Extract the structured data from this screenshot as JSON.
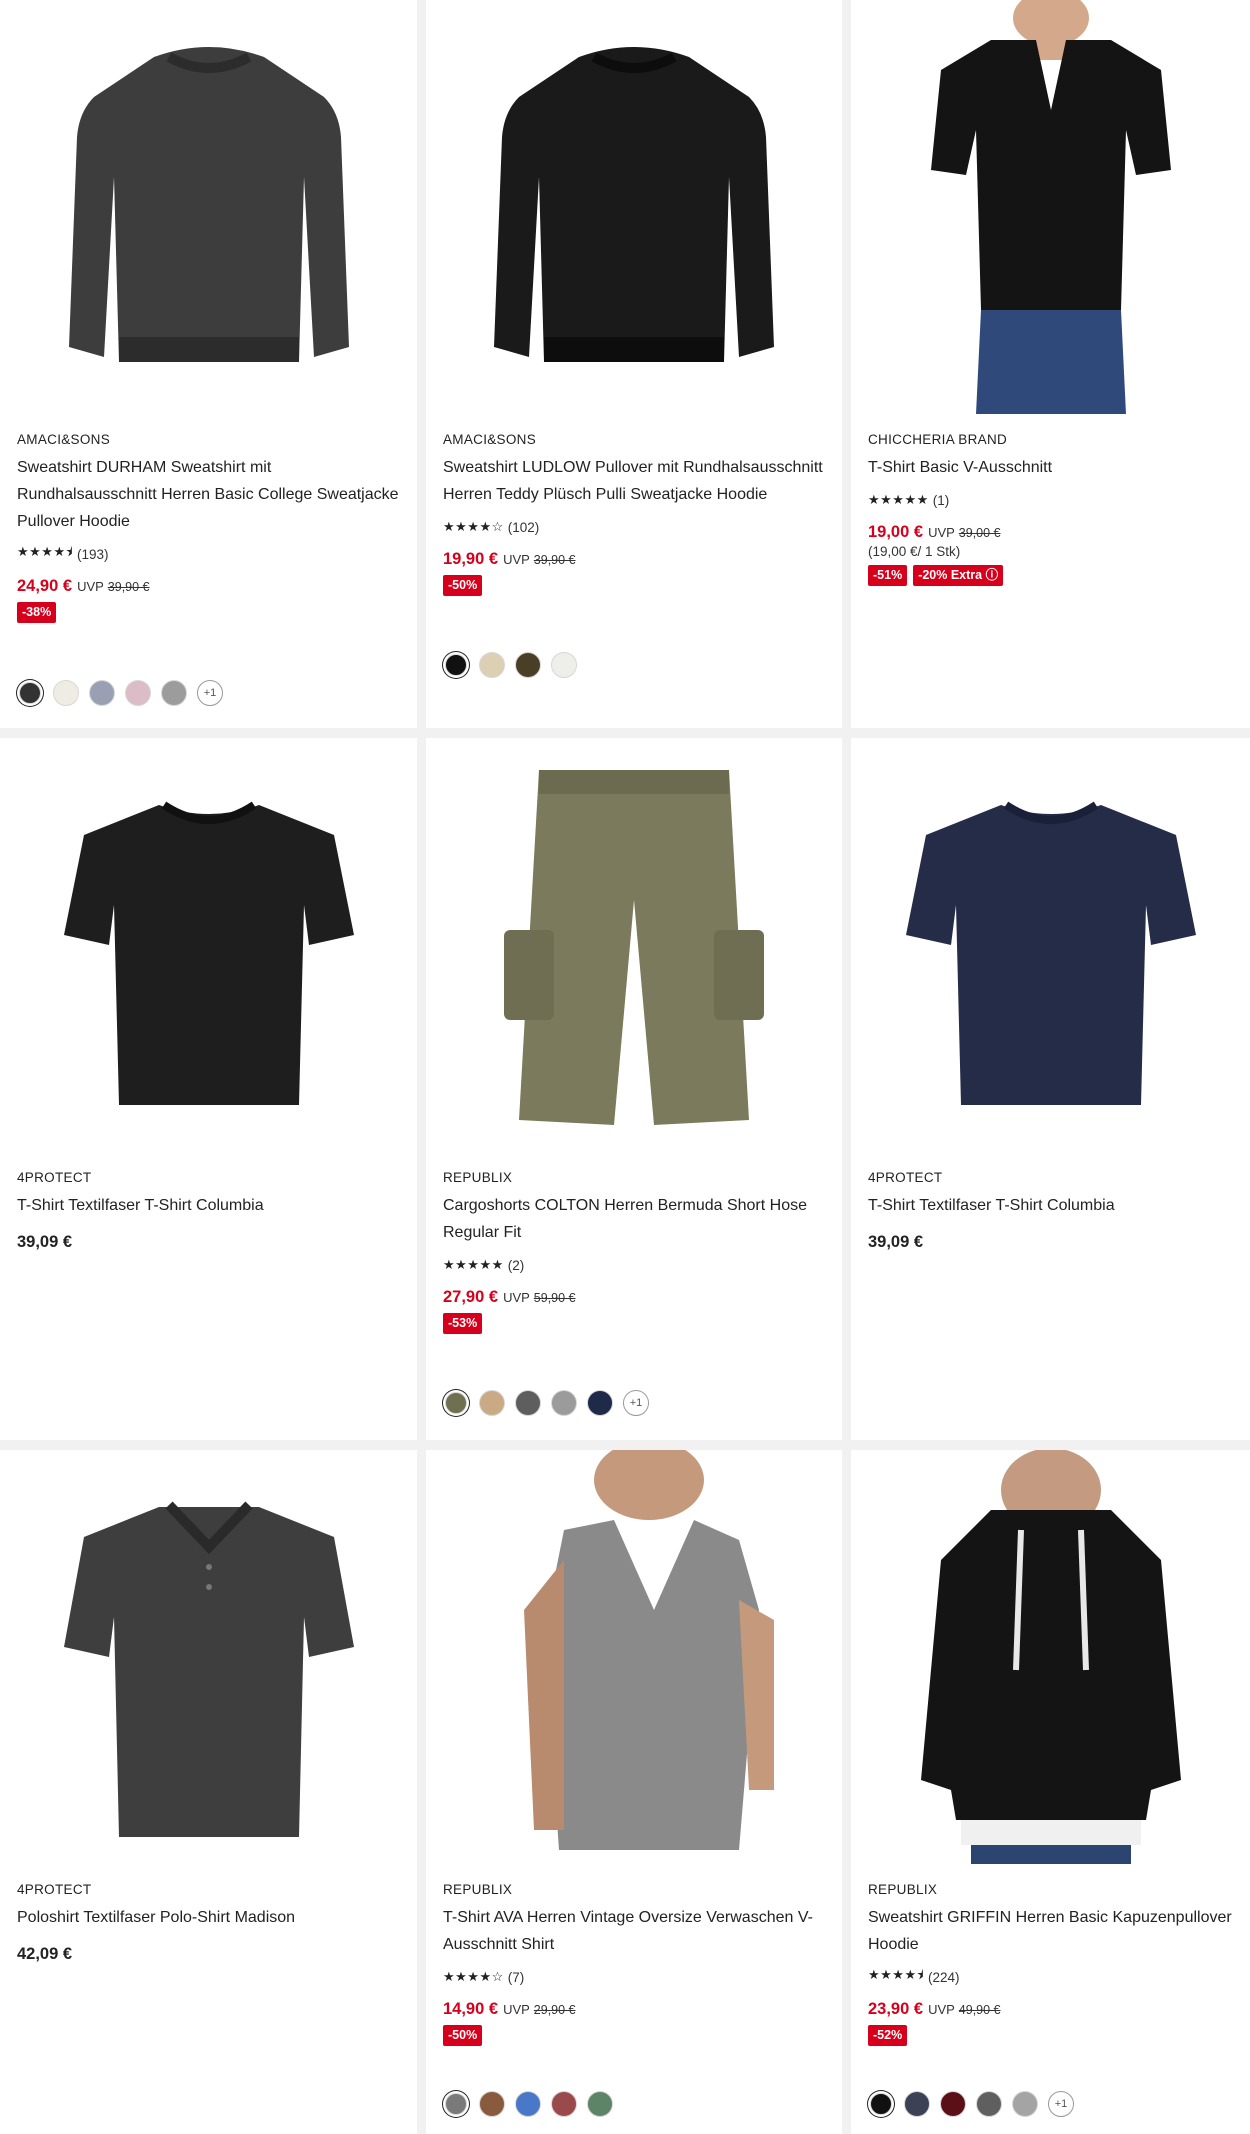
{
  "products": [
    {
      "brand": "AMACI&SONS",
      "title": "Sweatshirt DURHAM Sweatshirt mit Rundhalsausschnitt Herren Basic College Sweatjacke Pullover Hoodie",
      "stars": "★★★★⯨",
      "rating_count": "(193)",
      "price": "24,90 €",
      "uvp_label": "UVP",
      "old_price": "39,90 €",
      "badges": [
        "-38%"
      ],
      "swatch_colors": [
        "#333333",
        "#efece4",
        "#9aa0b4",
        "#dcbcc6",
        "#9c9c9c"
      ],
      "more_colors": "+1",
      "image": "sweatshirt-gray"
    },
    {
      "brand": "AMACI&SONS",
      "title": "Sweatshirt LUDLOW Pullover mit Rundhalsausschnitt Herren Teddy Plüsch Pulli Sweatjacke Hoodie",
      "stars": "★★★★☆",
      "rating_count": "(102)",
      "price": "19,90 €",
      "uvp_label": "UVP",
      "old_price": "39,90 €",
      "badges": [
        "-50%"
      ],
      "swatch_colors": [
        "#111111",
        "#dccfb4",
        "#4a3f26",
        "#efefe9"
      ],
      "image": "sweatshirt-black"
    },
    {
      "brand": "CHICCHERIA BRAND",
      "title": "T-Shirt Basic V-Ausschnitt",
      "stars": "★★★★★",
      "rating_count": "(1)",
      "price": "19,00 €",
      "uvp_label": "UVP",
      "old_price": "39,00 €",
      "unit_price": "(19,00 €/ 1 Stk)",
      "badges": [
        "-51%",
        "-20% Extra ⓘ"
      ],
      "image": "tshirt-vneck-model"
    },
    {
      "brand": "4PROTECT",
      "title": "T-Shirt Textilfaser T-Shirt Columbia",
      "price": "39,09 €",
      "image": "tshirt-black"
    },
    {
      "brand": "REPUBLIX",
      "title": "Cargoshorts COLTON Herren Bermuda Short Hose Regular Fit",
      "stars": "★★★★★",
      "rating_count": "(2)",
      "price": "27,90 €",
      "uvp_label": "UVP",
      "old_price": "59,90 €",
      "badges": [
        "-53%"
      ],
      "swatch_colors": [
        "#6e7050",
        "#c9aa84",
        "#5e5e5e",
        "#9b9b9b",
        "#1f2a48"
      ],
      "more_colors": "+1",
      "image": "cargo-shorts"
    },
    {
      "brand": "4PROTECT",
      "title": "T-Shirt Textilfaser T-Shirt Columbia",
      "price": "39,09 €",
      "image": "tshirt-navy"
    },
    {
      "brand": "4PROTECT",
      "title": "Poloshirt Textilfaser Polo-Shirt Madison",
      "price": "42,09 €",
      "image": "polo-gray"
    },
    {
      "brand": "REPUBLIX",
      "title": "T-Shirt AVA Herren Vintage Oversize Verwaschen V-Ausschnitt Shirt",
      "stars": "★★★★☆",
      "rating_count": "(7)",
      "price": "14,90 €",
      "uvp_label": "UVP",
      "old_price": "29,90 €",
      "badges": [
        "-50%"
      ],
      "swatch_colors": [
        "#7a7a7a",
        "#8a5a3c",
        "#4a78c8",
        "#9a4a4a",
        "#5d8466"
      ],
      "image": "tshirt-model-gray"
    },
    {
      "brand": "REPUBLIX",
      "title": "Sweatshirt GRIFFIN Herren Basic Kapuzenpullover Hoodie",
      "stars": "★★★★⯨",
      "rating_count": "(224)",
      "price": "23,90 €",
      "uvp_label": "UVP",
      "old_price": "49,90 €",
      "badges": [
        "-52%"
      ],
      "swatch_colors": [
        "#111111",
        "#3b4256",
        "#5b1018",
        "#5f5f5f",
        "#a4a4a4"
      ],
      "more_colors": "+1",
      "image": "hoodie-model-black"
    }
  ]
}
